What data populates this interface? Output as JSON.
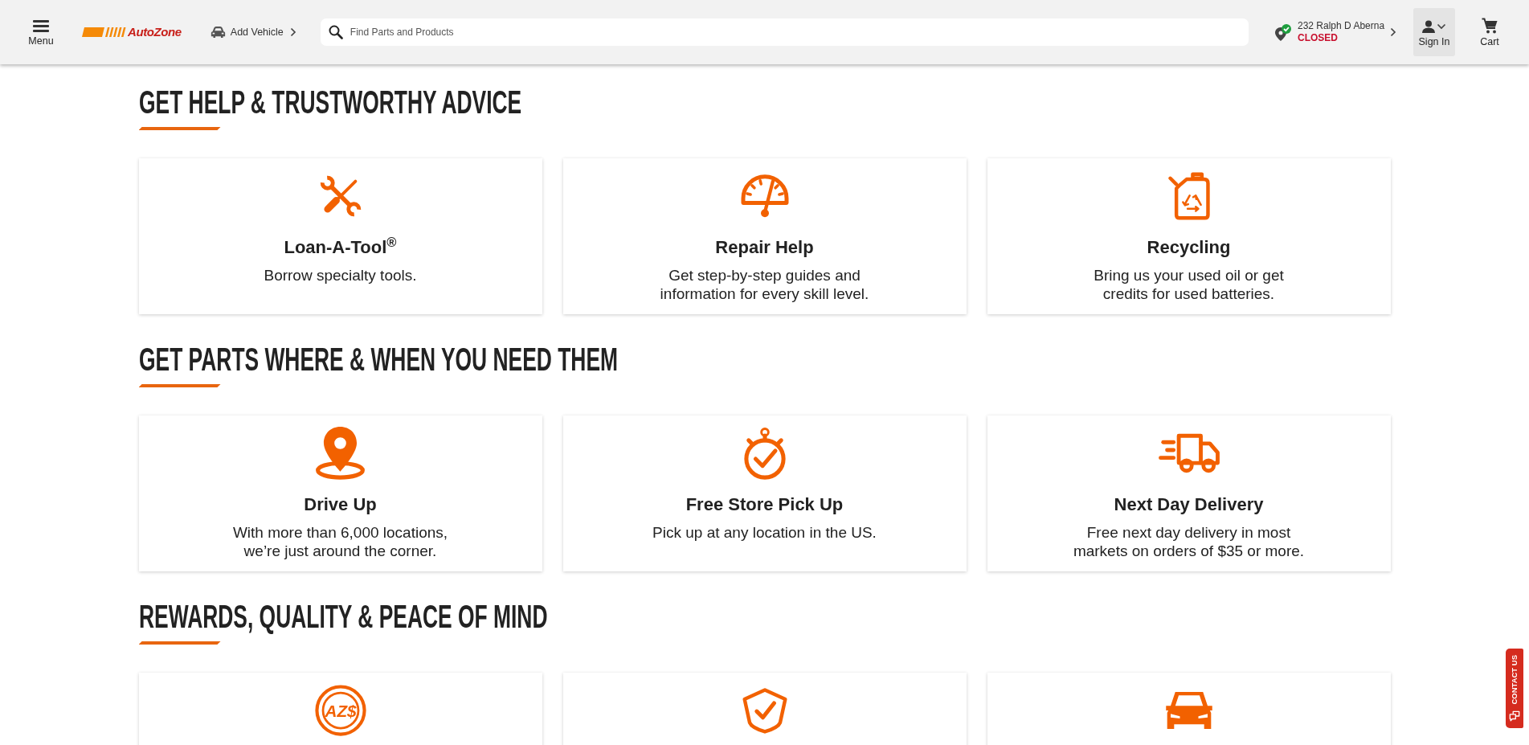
{
  "header": {
    "menu": {
      "label": "Menu"
    },
    "logo": {
      "text": "AutoZone"
    },
    "vehicle": {
      "label": "Add Vehicle"
    },
    "search": {
      "placeholder": "Find Parts and Products"
    },
    "store": {
      "name": "232 Ralph D Aberna",
      "status": "CLOSED",
      "open": false
    },
    "sign_in": {
      "label": "Sign In"
    },
    "cart": {
      "label": "Cart"
    }
  },
  "sections": [
    {
      "title": "GET HELP & TRUSTWORTHY ADVICE",
      "cards": [
        {
          "kind": "tools",
          "title": "Loan-A-Tool$^{®}$",
          "text": "Borrow specialty tools."
        },
        {
          "kind": "gauge",
          "title": "Repair Help",
          "text": "Get step-by-step guides and\ninformation for every skill level."
        },
        {
          "kind": "can",
          "title": "Recycling",
          "text": "Bring us your used oil or get\ncredits for used batteries."
        }
      ]
    },
    {
      "title": "GET PARTS WHERE & WHEN YOU NEED THEM",
      "cards": [
        {
          "kind": "pin",
          "title": "Drive Up",
          "text": "With more than 6,000 locations,\nwe’re just around the corner."
        },
        {
          "kind": "stopwatch",
          "title": "Free Store Pick Up",
          "text": "Pick up at any location in the US."
        },
        {
          "kind": "truck",
          "title": "Next Day Delivery",
          "text": "Free next day delivery in most\nmarkets on orders of $35 or more."
        }
      ]
    },
    {
      "title": "REWARDS, QUALITY & PEACE OF MIND",
      "cards": [
        {
          "kind": "coin",
          "icon_text": "AZ$"
        },
        {
          "kind": "shield"
        },
        {
          "kind": "car"
        }
      ]
    }
  ],
  "contact": {
    "label": "CONTACT US"
  }
}
